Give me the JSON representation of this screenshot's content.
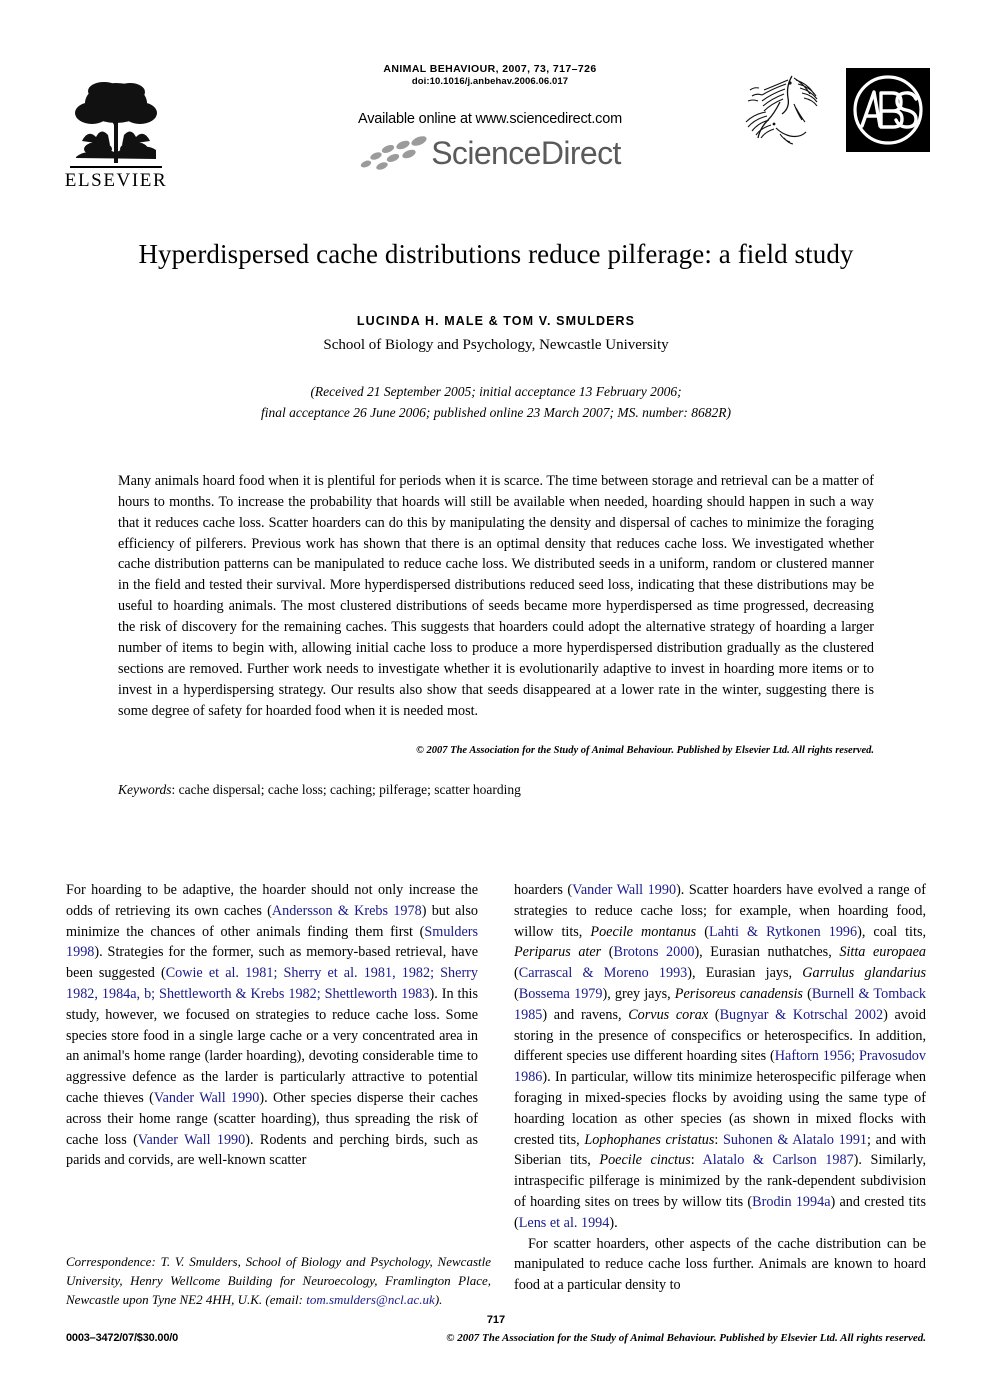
{
  "masthead": {
    "publisher_name": "ELSEVIER",
    "journal_line": "ANIMAL BEHAVIOUR, 2007, 73, 717–726",
    "doi_line": "doi:10.1016/j.anbehav.2006.06.017",
    "available_online": "Available online at www.sciencedirect.com",
    "sciencedirect_wordmark": "ScienceDirect"
  },
  "article": {
    "title": "Hyperdispersed cache distributions reduce pilferage: a field study",
    "authors": "LUCINDA H. MALE & TOM V. SMULDERS",
    "affiliation": "School of Biology and Psychology, Newcastle University",
    "dates_line1": "(Received 21 September 2005; initial acceptance 13 February 2006;",
    "dates_line2": "final acceptance 26 June 2006; published online 23 March 2007; MS. number: 8682R)"
  },
  "abstract": {
    "text": "Many animals hoard food when it is plentiful for periods when it is scarce. The time between storage and retrieval can be a matter of hours to months. To increase the probability that hoards will still be available when needed, hoarding should happen in such a way that it reduces cache loss. Scatter hoarders can do this by manipulating the density and dispersal of caches to minimize the foraging efficiency of pilferers. Previous work has shown that there is an optimal density that reduces cache loss. We investigated whether cache distribution patterns can be manipulated to reduce cache loss. We distributed seeds in a uniform, random or clustered manner in the field and tested their survival. More hyperdispersed distributions reduced seed loss, indicating that these distributions may be useful to hoarding animals. The most clustered distributions of seeds became more hyperdispersed as time progressed, decreasing the risk of discovery for the remaining caches. This suggests that hoarders could adopt the alternative strategy of hoarding a larger number of items to begin with, allowing initial cache loss to produce a more hyperdispersed distribution gradually as the clustered sections are removed. Further work needs to investigate whether it is evolutionarily adaptive to invest in hoarding more items or to invest in a hyperdispersing strategy. Our results also show that seeds disappeared at a lower rate in the winter, suggesting there is some degree of safety for hoarded food when it is needed most.",
    "copyright": "© 2007 The Association for the Study of Animal Behaviour. Published by Elsevier Ltd. All rights reserved.",
    "keywords_label": "Keywords",
    "keywords_value": ": cache dispersal; cache loss; caching; pilferage; scatter hoarding"
  },
  "body": {
    "left_column": [
      {
        "indent": false,
        "runs": [
          {
            "t": "For hoarding to be adaptive, the hoarder should not only increase the odds of retrieving its own caches (",
            "s": "plain"
          },
          {
            "t": "Andersson & Krebs 1978",
            "s": "cite"
          },
          {
            "t": ") but also minimize the chances of other animals finding them first (",
            "s": "plain"
          },
          {
            "t": "Smulders 1998",
            "s": "cite"
          },
          {
            "t": "). Strategies for the former, such as memory-based retrieval, have been suggested (",
            "s": "plain"
          },
          {
            "t": "Cowie et al. 1981; Sherry et al. 1981, 1982; Sherry 1982, 1984a, b; Shettleworth & Krebs 1982; Shettleworth 1983",
            "s": "cite"
          },
          {
            "t": "). In this study, however, we focused on strategies to reduce cache loss. Some species store food in a single large cache or a very concentrated area in an animal's home range (larder hoarding), devoting considerable time to aggressive defence as the larder is particularly attractive to potential cache thieves (",
            "s": "plain"
          },
          {
            "t": "Vander Wall 1990",
            "s": "cite"
          },
          {
            "t": "). Other species disperse their caches across their home range (scatter hoarding), thus spreading the risk of cache loss (",
            "s": "plain"
          },
          {
            "t": "Vander Wall 1990",
            "s": "cite"
          },
          {
            "t": "). Rodents and perching birds, such as parids and corvids, are well-known scatter",
            "s": "plain"
          }
        ]
      }
    ],
    "right_column": [
      {
        "indent": false,
        "runs": [
          {
            "t": "hoarders (",
            "s": "plain"
          },
          {
            "t": "Vander Wall 1990",
            "s": "cite"
          },
          {
            "t": "). Scatter hoarders have evolved a range of strategies to reduce cache loss; for example, when hoarding food, willow tits, ",
            "s": "plain"
          },
          {
            "t": "Poecile montanus",
            "s": "italic"
          },
          {
            "t": " (",
            "s": "plain"
          },
          {
            "t": "Lahti & Rytkonen 1996",
            "s": "cite"
          },
          {
            "t": "), coal tits, ",
            "s": "plain"
          },
          {
            "t": "Periparus ater",
            "s": "italic"
          },
          {
            "t": " (",
            "s": "plain"
          },
          {
            "t": "Brotons 2000",
            "s": "cite"
          },
          {
            "t": "), Eurasian nuthatches, ",
            "s": "plain"
          },
          {
            "t": "Sitta europaea",
            "s": "italic"
          },
          {
            "t": " (",
            "s": "plain"
          },
          {
            "t": "Carrascal & Moreno 1993",
            "s": "cite"
          },
          {
            "t": "), Eurasian jays, ",
            "s": "plain"
          },
          {
            "t": "Garrulus glandarius",
            "s": "italic"
          },
          {
            "t": " (",
            "s": "plain"
          },
          {
            "t": "Bossema 1979",
            "s": "cite"
          },
          {
            "t": "), grey jays, ",
            "s": "plain"
          },
          {
            "t": "Perisoreus canadensis",
            "s": "italic"
          },
          {
            "t": " (",
            "s": "plain"
          },
          {
            "t": "Burnell & Tomback 1985",
            "s": "cite"
          },
          {
            "t": ") and ravens, ",
            "s": "plain"
          },
          {
            "t": "Corvus corax",
            "s": "italic"
          },
          {
            "t": " (",
            "s": "plain"
          },
          {
            "t": "Bugnyar & Kotrschal 2002",
            "s": "cite"
          },
          {
            "t": ") avoid storing in the presence of conspecifics or heterospecifics. In addition, different species use different hoarding sites (",
            "s": "plain"
          },
          {
            "t": "Haftorn 1956; Pravosudov 1986",
            "s": "cite"
          },
          {
            "t": "). In particular, willow tits minimize heterospecific pilferage when foraging in mixed-species flocks by avoiding using the same type of hoarding location as other species (as shown in mixed flocks with crested tits, ",
            "s": "plain"
          },
          {
            "t": "Lophophanes cristatus",
            "s": "italic"
          },
          {
            "t": ": ",
            "s": "plain"
          },
          {
            "t": "Suhonen & Alatalo 1991",
            "s": "cite"
          },
          {
            "t": "; and with Siberian tits, ",
            "s": "plain"
          },
          {
            "t": "Poecile cinctus",
            "s": "italic"
          },
          {
            "t": ": ",
            "s": "plain"
          },
          {
            "t": "Alatalo & Carlson 1987",
            "s": "cite"
          },
          {
            "t": "). Similarly, intraspecific pilferage is minimized by the rank-dependent subdivision of hoarding sites on trees by willow tits (",
            "s": "plain"
          },
          {
            "t": "Brodin 1994a",
            "s": "cite"
          },
          {
            "t": ") and crested tits (",
            "s": "plain"
          },
          {
            "t": "Lens et al. 1994",
            "s": "cite"
          },
          {
            "t": ").",
            "s": "plain"
          }
        ]
      },
      {
        "indent": true,
        "runs": [
          {
            "t": "For scatter hoarders, other aspects of the cache distribution can be manipulated to reduce cache loss further. Animals are known to hoard food at a particular density to",
            "s": "plain"
          }
        ]
      }
    ]
  },
  "correspondence": {
    "runs": [
      {
        "t": "Correspondence: T. V. Smulders, School of Biology and Psychology, Newcastle University, Henry Wellcome Building for Neuroecology, Framlington Place, Newcastle upon Tyne NE2 4HH, U.K. (email: ",
        "s": "plain"
      },
      {
        "t": "tom.smulders@ncl.ac.uk",
        "s": "email"
      },
      {
        "t": ").",
        "s": "plain"
      }
    ]
  },
  "footer": {
    "page_number": "717",
    "issn_line": "0003–3472/07/$30.00/0",
    "copyright": "© 2007 The Association for the Study of Animal Behaviour. Published by Elsevier Ltd. All rights reserved."
  }
}
